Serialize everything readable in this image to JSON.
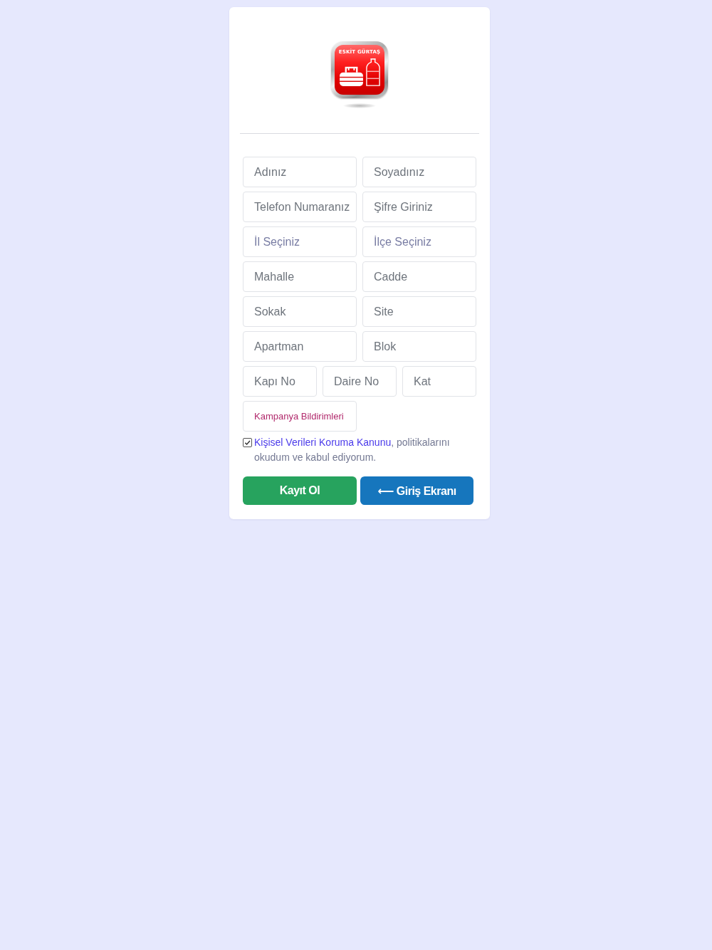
{
  "logo": {
    "title": "ESKİT GÜRTAŞ"
  },
  "form": {
    "rows": [
      [
        {
          "kind": "input",
          "placeholder": "Adınız"
        },
        {
          "kind": "input",
          "placeholder": "Soyadınız"
        }
      ],
      [
        {
          "kind": "input",
          "placeholder": "Telefon Numaranız"
        },
        {
          "kind": "input",
          "placeholder": "Şifre Giriniz"
        }
      ],
      [
        {
          "kind": "select",
          "value": "İl Seçiniz"
        },
        {
          "kind": "select",
          "value": "İlçe Seçiniz"
        }
      ],
      [
        {
          "kind": "input",
          "placeholder": "Mahalle"
        },
        {
          "kind": "input",
          "placeholder": "Cadde"
        }
      ],
      [
        {
          "kind": "input",
          "placeholder": "Sokak"
        },
        {
          "kind": "input",
          "placeholder": "Site"
        }
      ],
      [
        {
          "kind": "input",
          "placeholder": "Apartman"
        },
        {
          "kind": "input",
          "placeholder": "Blok"
        }
      ],
      [
        {
          "kind": "input",
          "placeholder": "Kapı No"
        },
        {
          "kind": "input",
          "placeholder": "Daire No"
        },
        {
          "kind": "input",
          "placeholder": "Kat"
        }
      ]
    ],
    "campaign_select": {
      "value": "Kampanya Bildirimleri"
    }
  },
  "consent": {
    "checked": true,
    "link": "Kişisel Verileri Koruma Kanunu",
    "text": ", politikalarını okudum ve kabul ediyorum."
  },
  "buttons": [
    {
      "kind": "success",
      "label": "Kayıt Ol"
    },
    {
      "kind": "primary",
      "label": "⟵ Giriş Ekranı"
    }
  ]
}
